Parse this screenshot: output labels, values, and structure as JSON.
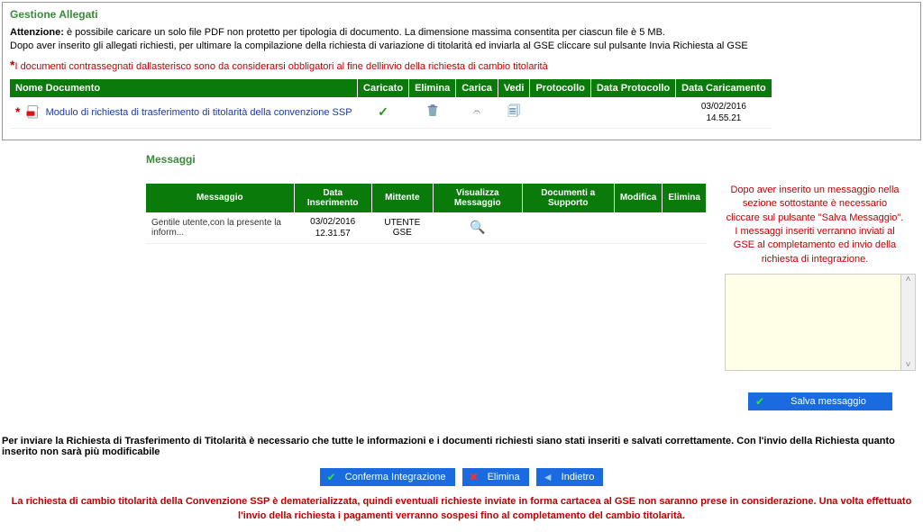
{
  "allegati": {
    "title": "Gestione Allegati",
    "intro_bold": "Attenzione:",
    "intro": " è possibile caricare un solo file PDF non protetto per tipologia di documento. La dimensione massima consentita per ciascun file è 5 MB.\nDopo aver inserito gli allegati richiesti, per ultimare la compilazione della richiesta di variazione di titolarità ed inviarla al GSE cliccare sul pulsante Invia Richiesta al GSE",
    "note_red": "I documenti contrassegnati dallasterisco sono da considerarsi obbligatori al fine dellinvio della richiesta di cambio titolarità",
    "asterisk": "*",
    "headers": {
      "nome": "Nome Documento",
      "caricato": "Caricato",
      "elimina": "Elimina",
      "carica": "Carica",
      "vedi": "Vedi",
      "protocollo": "Protocollo",
      "data_protocollo": "Data Protocollo",
      "data_caricamento": "Data Caricamento"
    },
    "rows": [
      {
        "nome": "Modulo di richiesta di trasferimento di titolarità della convenzione SSP",
        "caricato": "✓",
        "data_caricamento": "03/02/2016\n14.55.21"
      }
    ]
  },
  "messaggi": {
    "title": "Messaggi",
    "info_red": "Dopo aver inserito un messaggio nella sezione sottostante è necessario cliccare sul pulsante \"Salva Messaggio\".\nI messaggi inseriti verranno inviati al GSE al completamento ed invio della richiesta di integrazione.",
    "headers": {
      "messaggio": "Messaggio",
      "data_inserimento": "Data Inserimento",
      "mittente": "Mittente",
      "visualizza": "Visualizza Messaggio",
      "supporto": "Documenti a Supporto",
      "modifica": "Modifica",
      "elimina": "Elimina"
    },
    "rows": [
      {
        "messaggio": "Gentile utente,con la presente la inform...",
        "data": "03/02/2016\n12.31.57",
        "mittente": "UTENTE GSE"
      }
    ],
    "textarea_value": "",
    "save_label": "Salva messaggio"
  },
  "footer": {
    "bold_line": "Per inviare la Richiesta di Trasferimento di Titolarità è necessario che tutte le informazioni e i documenti richiesti siano stati inseriti e salvati correttamente. Con l'invio della Richiesta quanto inserito non sarà più modificabile",
    "buttons": {
      "conferma": "Conferma Integrazione",
      "elimina": "Elimina",
      "indietro": "Indietro"
    },
    "red_line": "La richiesta di cambio titolarità della Convenzione SSP è dematerializzata, quindi eventuali richieste inviate in forma cartacea al GSE non saranno prese in considerazione. Una volta effettuato l'invio della richiesta i pagamenti verranno sospesi fino al completamento del cambio titolarità."
  }
}
